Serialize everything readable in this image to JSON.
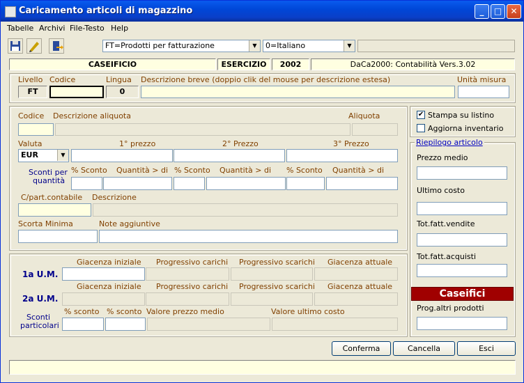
{
  "window": {
    "title": "Caricamento articoli di magazzino"
  },
  "menu": [
    "Tabelle",
    "Archivi",
    "File-Testo",
    "Help"
  ],
  "toolbar": {
    "icons": [
      "save-icon",
      "edit-icon",
      "exit-icon"
    ],
    "doc_type": "FT=Prodotti per fatturazione",
    "language_select": "0=Italiano"
  },
  "info": {
    "company": "CASEIFICIO",
    "esercizio_label": "ESERCIZIO",
    "year": "2002",
    "app_version": "DaCa2000: Contabilità Vers.3.02"
  },
  "header_row": {
    "livello_label": "Livello",
    "livello_value": "FT",
    "codice_label": "Codice",
    "lingua_label": "Lingua",
    "lingua_value": "0",
    "descr_label": "Descrizione breve (doppio clik del mouse per descrizione estesa)",
    "um_label": "Unità misura"
  },
  "main": {
    "codice_label": "Codice",
    "descr_aliquota_label": "Descrizione aliquota",
    "aliquota_label": "Aliquota",
    "valuta_label": "Valuta",
    "valuta_value": "EUR",
    "prezzo1_label": "1° prezzo",
    "prezzo2_label": "2° Prezzo",
    "prezzo3_label": "3° Prezzo",
    "sconti_label_1": "Sconti per",
    "sconti_label_2": "quantità",
    "sconto_label": "% Sconto",
    "qta_label": "Quantità > di",
    "cpart_label": "C/part.contabile",
    "descrizione_label": "Descrizione",
    "scorta_label": "Scorta Minima",
    "note_label": "Note aggiuntive"
  },
  "stock": {
    "um1_label": "1a U.M.",
    "um2_label": "2a U.M.",
    "giacenza_iniziale": "Giacenza iniziale",
    "prog_carichi": "Progressivo carichi",
    "prog_scarichi": "Progressivo scarichi",
    "giacenza_attuale": "Giacenza attuale",
    "sconti_part_1": "Sconti",
    "sconti_part_2": "particolari",
    "psconto_label": "% sconto",
    "valore_medio": "Valore prezzo medio",
    "valore_ultimo": "Valore ultimo costo"
  },
  "side": {
    "stampa_listino": "Stampa su listino",
    "stampa_checked": true,
    "aggiorna_inventario": "Aggiorna inventario",
    "aggiorna_checked": false,
    "riepilogo_link": "Riepilogo articolo",
    "prezzo_medio": "Prezzo medio",
    "ultimo_costo": "Ultimo costo",
    "tot_vendite": "Tot.fatt.vendite",
    "tot_acquisti": "Tot.fatt.acquisti",
    "category_banner": "Caseifici",
    "prog_altri": "Prog.altri prodotti",
    "banner_color": "#a00000"
  },
  "buttons": {
    "conferma": "Conferma",
    "cancella": "Cancella",
    "esci": "Esci"
  }
}
